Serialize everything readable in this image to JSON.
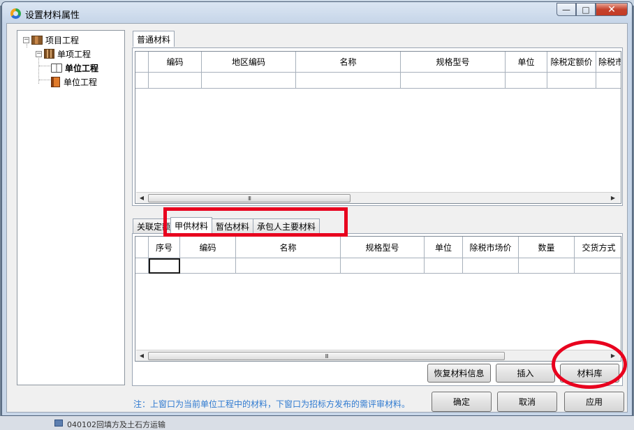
{
  "window": {
    "title": "设置材料属性"
  },
  "tree": {
    "root": "项目工程",
    "sub": "单项工程",
    "unit_selected": "单位工程",
    "unit_other": "单位工程"
  },
  "upper": {
    "tab": "普通材料",
    "columns": [
      "编码",
      "地区编码",
      "名称",
      "规格型号",
      "单位",
      "除税定额价",
      "除税市"
    ]
  },
  "lower": {
    "tabs": [
      "关联定额",
      "甲供材料",
      "暂估材料",
      "承包人主要材料"
    ],
    "active_tab": "甲供材料",
    "columns": [
      "序号",
      "编码",
      "名称",
      "规格型号",
      "单位",
      "除税市场价",
      "数量",
      "交货方式"
    ]
  },
  "scroll": {
    "thumb_grip": "III"
  },
  "buttons": {
    "restore": "恢复材料信息",
    "insert": "插入",
    "library": "材料库",
    "ok": "确定",
    "cancel": "取消",
    "apply": "应用"
  },
  "note": "注：上窗口为当前单位工程中的材料，下窗口为招标方发布的需评审材料。",
  "annotation_color": "#e8001e",
  "icons": [
    "app-logo-icon",
    "minimize-icon",
    "maximize-icon",
    "close-icon",
    "project-icon",
    "sub-project-icon",
    "open-book-icon",
    "book-icon"
  ],
  "background_text": "040102回填方及土石方运输"
}
